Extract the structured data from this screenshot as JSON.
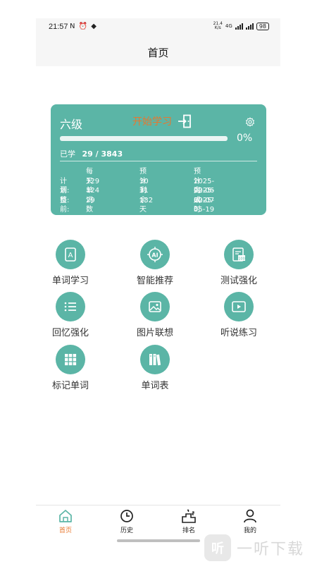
{
  "status_bar": {
    "time": "21:57",
    "left_icons": "N ⏰ ◆",
    "net_speed_value": "21.4",
    "net_speed_unit": "K/s",
    "network": "4G",
    "battery": "98"
  },
  "header": {
    "title": "首页"
  },
  "card": {
    "level": "六级",
    "start_label": "开始学习",
    "progress_value": 0,
    "progress_text": "0%",
    "learned_label": "已学",
    "learned_count": "29 / 3843",
    "stats": {
      "headers": [
        "每天单词数",
        "预计剩余天数",
        "预计完成时间"
      ],
      "rows": [
        {
          "label": "计划:",
          "per_day": "129",
          "remaining_days": "30",
          "finish_date": "2025-02-06"
        },
        {
          "label": "调整:",
          "per_day": "124",
          "remaining_days": "31",
          "finish_date": "2025-02-07"
        },
        {
          "label": "目前:",
          "per_day": "29",
          "remaining_days": "132",
          "finish_date": "2025-05-19"
        }
      ]
    }
  },
  "features": [
    {
      "label": "单词学习",
      "icon": "word-book-icon"
    },
    {
      "label": "智能推荐",
      "icon": "ai-icon"
    },
    {
      "label": "测试强化",
      "icon": "test-icon"
    },
    {
      "label": "回忆强化",
      "icon": "list-icon"
    },
    {
      "label": "图片联想",
      "icon": "image-icon"
    },
    {
      "label": "听说练习",
      "icon": "video-icon"
    },
    {
      "label": "标记单词",
      "icon": "grid-icon"
    },
    {
      "label": "单词表",
      "icon": "books-icon"
    }
  ],
  "bottom_nav": [
    {
      "label": "首页",
      "icon": "home-icon",
      "active": true
    },
    {
      "label": "历史",
      "icon": "clock-icon",
      "active": false
    },
    {
      "label": "排名",
      "icon": "ranking-icon",
      "active": false
    },
    {
      "label": "我的",
      "icon": "user-icon",
      "active": false
    }
  ],
  "watermark": {
    "logo_text": "听",
    "text": "一听下载"
  },
  "colors": {
    "accent": "#5bb5a6",
    "start": "#e8772e",
    "active_nav": "#e8772e"
  }
}
